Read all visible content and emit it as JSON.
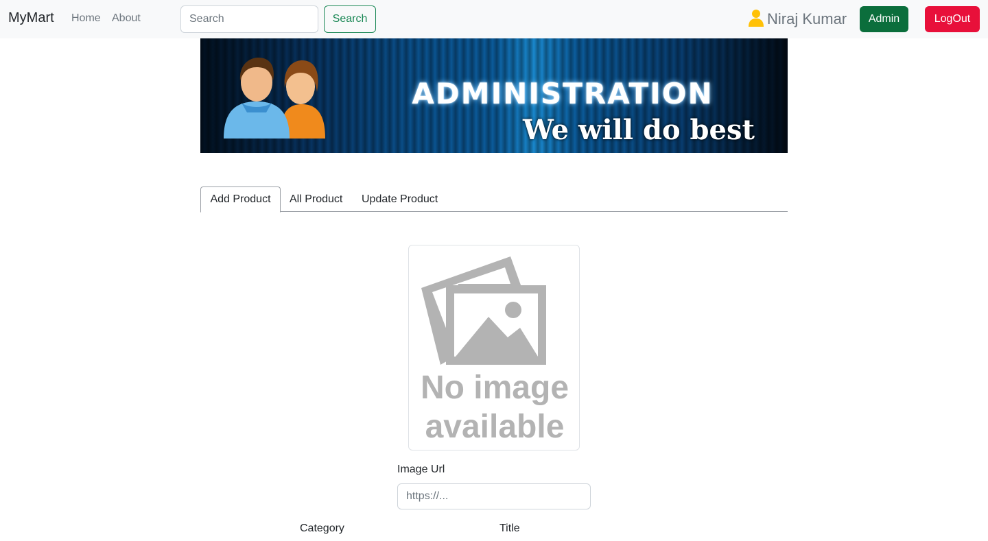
{
  "navbar": {
    "brand": "MyMart",
    "links": [
      "Home",
      "About"
    ],
    "search_placeholder": "Search",
    "search_button": "Search",
    "user_icon": "user-icon",
    "user_name": "Niraj Kumar",
    "admin_button": "Admin",
    "logout_button": "LogOut",
    "colors": {
      "background": "#f8f9fa",
      "search_outline": "#198754",
      "admin": "#0b6e3c",
      "logout": "#e8103a",
      "user_icon": "#ffc107"
    }
  },
  "banner": {
    "title": "ADMINISTRATION",
    "subtitle": "We will do best",
    "icon": "people-icon"
  },
  "tabs": [
    {
      "label": "Add Product",
      "active": true
    },
    {
      "label": "All Product",
      "active": false
    },
    {
      "label": "Update Product",
      "active": false
    }
  ],
  "image_preview": {
    "icon": "image-placeholder-icon",
    "line1": "No image",
    "line2": "available"
  },
  "form": {
    "image_url_label": "Image Url",
    "image_url_placeholder": "https://...",
    "category_label": "Category",
    "title_label": "Title"
  }
}
